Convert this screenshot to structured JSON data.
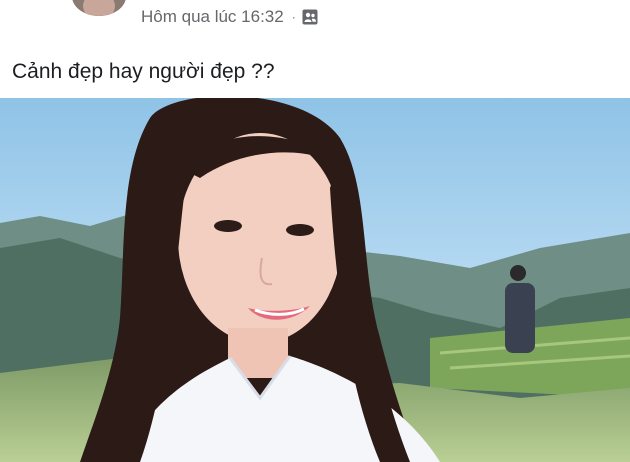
{
  "post": {
    "timestamp": "Hôm qua lúc 16:32",
    "separator": "·",
    "audience_icon": "group-audience-icon",
    "caption": "Cảnh đẹp hay người đẹp ??"
  },
  "photo": {
    "subject": "selfie-landscape-photo",
    "colors": {
      "sky_top": "#8fc3e6",
      "sky_bottom": "#dcefff",
      "mountain": "#4f6f62",
      "field": "#9bb57a",
      "hair": "#2b1a15",
      "skin": "#f3cfc1",
      "shirt": "#f4f6fa"
    }
  }
}
